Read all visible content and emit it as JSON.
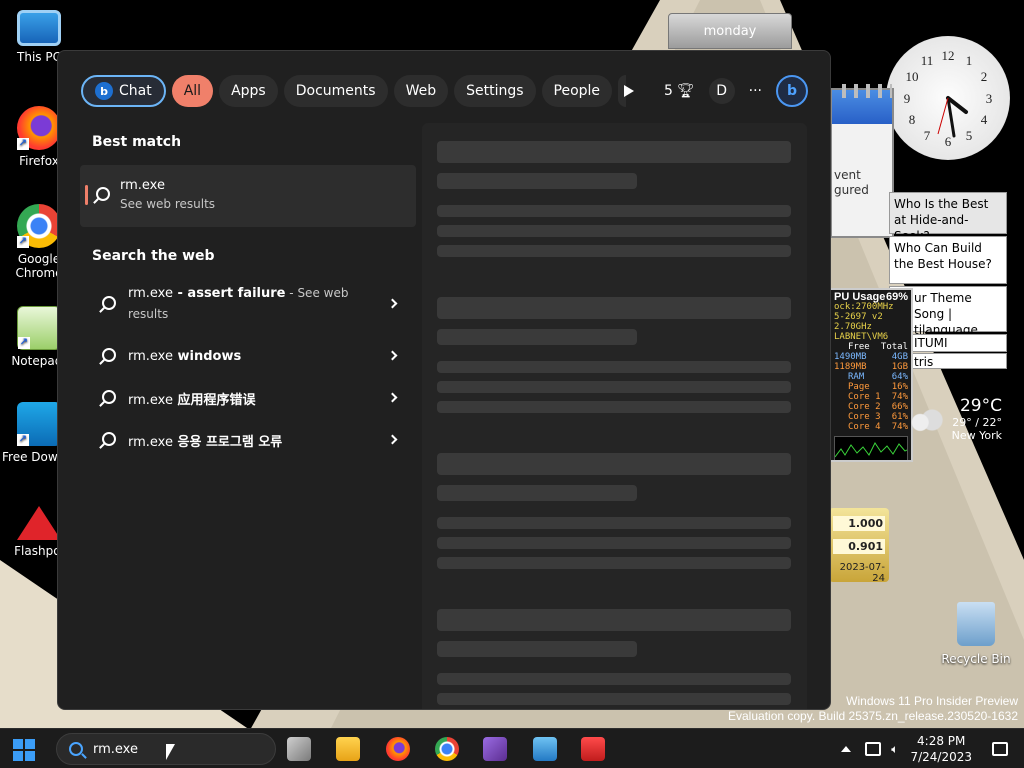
{
  "desktop": {
    "icons": [
      {
        "label": "This PC",
        "icon": "monitor-icon"
      },
      {
        "label": "Firefox",
        "icon": "firefox-icon"
      },
      {
        "label": "Google Chrome",
        "icon": "chrome-icon"
      },
      {
        "label": "Notepad-",
        "icon": "notepad-icon"
      },
      {
        "label": "Free Downlo",
        "icon": "download-icon"
      },
      {
        "label": "Flashpoi",
        "icon": "flashpoint-icon"
      }
    ],
    "recycle_bin": "Recycle Bin"
  },
  "gadgets": {
    "note_tab": "monday",
    "calendar_text": [
      "vent",
      "gured"
    ],
    "quiz_items": [
      "Who Is the Best at Hide-and-Seek?",
      "Who Can Build the Best House?",
      "ur Theme Song | tilanguage",
      "ITUMI",
      "tris"
    ],
    "cpu": {
      "title": "PU Usage",
      "percent": "69%",
      "line1": "ock:2700MHz",
      "line2": "5-2697 v2 2.70GHz",
      "line3": "LABNET\\VM6",
      "header": [
        "Free",
        "Total"
      ],
      "mem_rows": [
        [
          "1490MB",
          "4GB"
        ],
        [
          "1189MB",
          "1GB"
        ]
      ],
      "stat_rows": [
        [
          "RAM",
          "64%"
        ],
        [
          "Page",
          "16%"
        ],
        [
          "Core 1",
          "74%"
        ],
        [
          "Core 2",
          "66%"
        ],
        [
          "Core 3",
          "61%"
        ],
        [
          "Core 4",
          "74%"
        ]
      ]
    },
    "weather": {
      "temp": "29°C",
      "range": "29° / 22°",
      "city": "New York"
    },
    "currency": {
      "v1": "1.000",
      "v2": "0.901",
      "date": "2023-07-24"
    }
  },
  "watermark": {
    "line1": "Windows 11 Pro Insider Preview",
    "line2": "Evaluation copy. Build 25375.zn_release.230520-1632"
  },
  "search": {
    "chips": [
      {
        "label": "Chat",
        "state": "chat"
      },
      {
        "label": "All",
        "state": "active"
      },
      {
        "label": "Apps",
        "state": ""
      },
      {
        "label": "Documents",
        "state": ""
      },
      {
        "label": "Web",
        "state": ""
      },
      {
        "label": "Settings",
        "state": ""
      },
      {
        "label": "People",
        "state": ""
      }
    ],
    "points": "5",
    "avatar_letter": "D",
    "more": "···",
    "best_match_title": "Best match",
    "best_match": {
      "name": "rm.exe",
      "sub": "See web results"
    },
    "search_web_title": "Search the web",
    "web_results": [
      {
        "prefix": "rm.exe",
        "bold": " - assert failure",
        "muted": " - See web results"
      },
      {
        "prefix": "rm.exe",
        "bold": " windows",
        "muted": ""
      },
      {
        "prefix": "rm.exe",
        "bold": " 应用程序错误",
        "muted": ""
      },
      {
        "prefix": "rm.exe",
        "bold": " 응용 프로그램 오류",
        "muted": ""
      }
    ]
  },
  "taskbar": {
    "search_value": "rm.exe",
    "time": "4:28 PM",
    "date": "7/24/2023",
    "apps": [
      "task-view-icon",
      "file-explorer-icon",
      "firefox-icon",
      "chrome-icon",
      "visual-studio-icon",
      "control-panel-icon",
      "news-app-icon"
    ]
  },
  "colors": {
    "accent": "#f0806a",
    "bing": "#4ea2ff",
    "panel": "#202020"
  }
}
